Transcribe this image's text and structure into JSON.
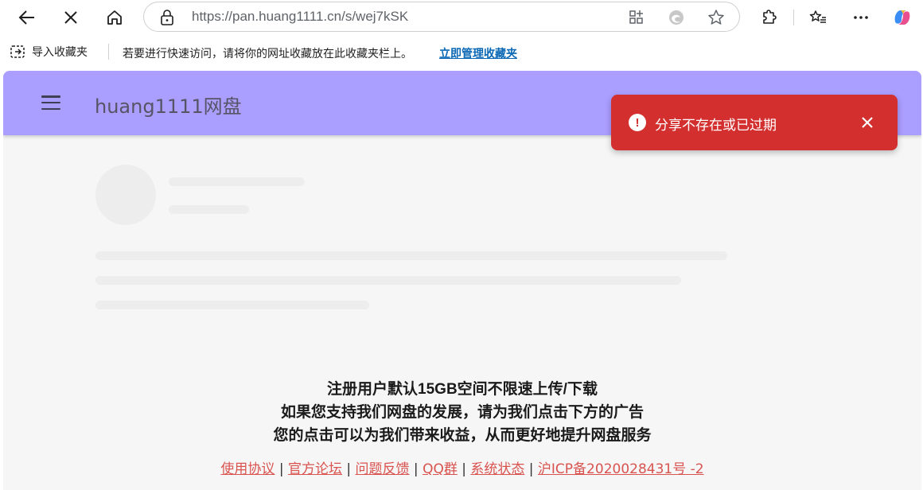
{
  "browser": {
    "url": "https://pan.huang1111.cn/s/wej7kSK"
  },
  "bookmarks": {
    "import_label": "导入收藏夹",
    "hint": "若要进行快速访问，请将你的网址收藏放在此收藏夹栏上。",
    "manage_link": "立即管理收藏夹"
  },
  "app": {
    "title": "huang1111网盘"
  },
  "toast": {
    "message": "分享不存在或已过期",
    "icon": "!"
  },
  "notice": {
    "line1": "注册用户默认15GB空间不限速上传/下载",
    "line2": "如果您支持我们网盘的发展，请为我们点击下方的广告",
    "line3": "您的点击可以为我们带来收益，从而更好地提升网盘服务"
  },
  "footer": {
    "links": [
      "使用协议",
      "官方论坛",
      "问题反馈",
      "QQ群",
      "系统状态",
      "沪ICP备2020028431号 -2"
    ],
    "separator": "|"
  },
  "colors": {
    "appbar": "#aa9eff",
    "toast": "#d32f2f",
    "link": "#d9534f"
  }
}
